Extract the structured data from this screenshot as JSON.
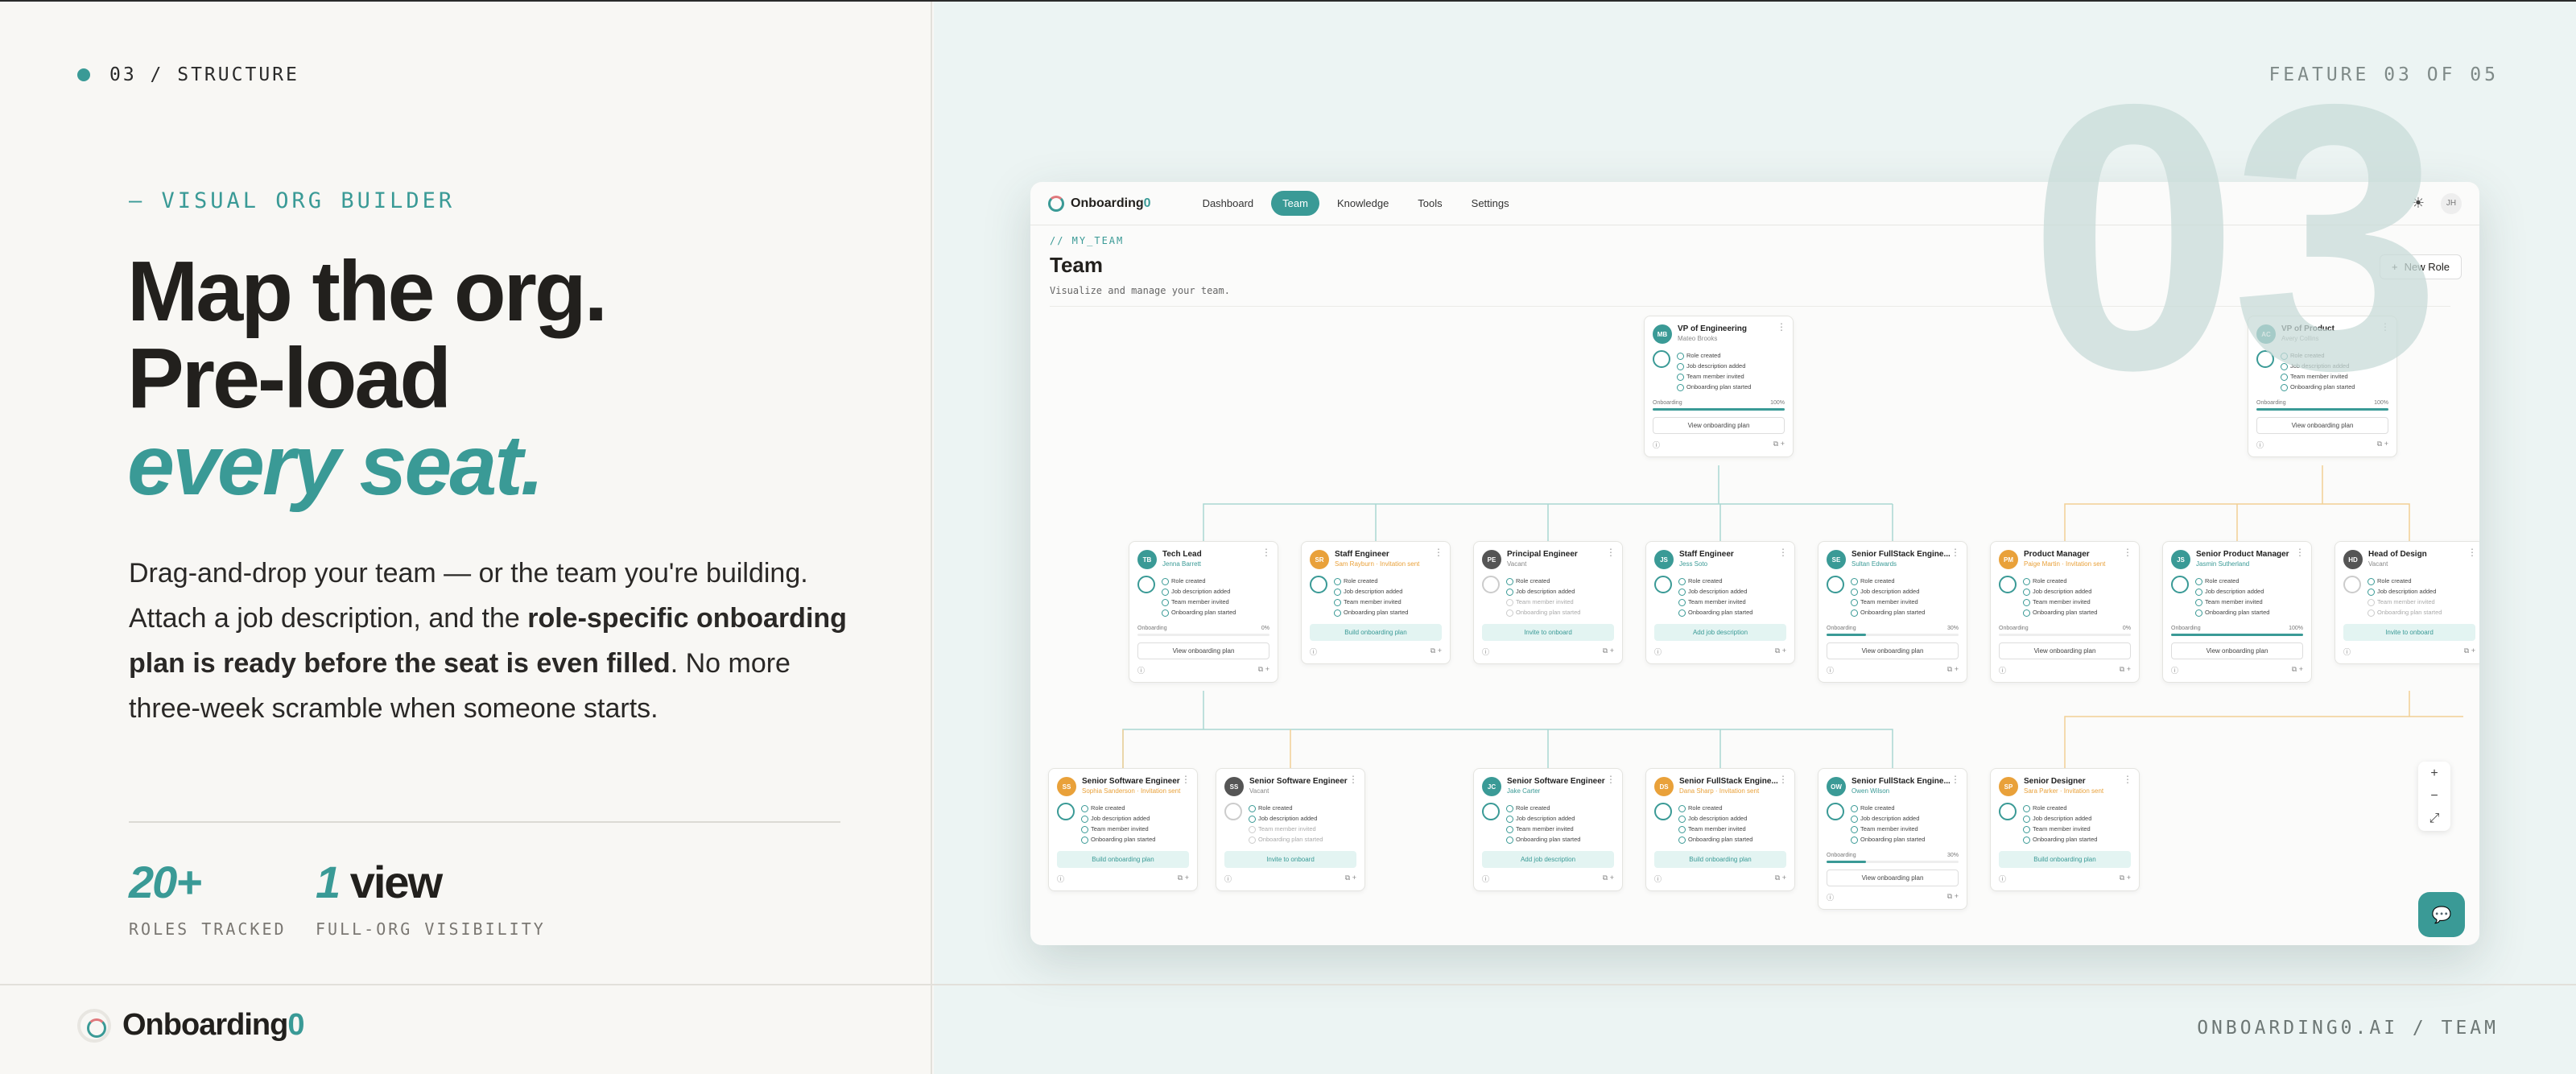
{
  "section": {
    "label": "03 / STRUCTURE"
  },
  "feature_label": "FEATURE 03 OF 05",
  "big_number": "03",
  "eyebrow": "— VISUAL ORG BUILDER",
  "headline": {
    "line1": "Map the org.",
    "line2": "Pre-load",
    "line3": "every seat."
  },
  "body": {
    "part1": "Drag-and-drop your team — or the team you're building. Attach a job description, and the ",
    "bold": "role-specific onboarding plan is ready before the seat is even filled",
    "part2": ". No more three-week scramble when someone starts."
  },
  "stats": [
    {
      "num": "20+",
      "rest": "",
      "caption": "ROLES TRACKED"
    },
    {
      "num": "1",
      "rest": " view",
      "caption": "FULL-ORG VISIBILITY"
    }
  ],
  "brand": {
    "name_main": "Onboarding",
    "name_zero": "0"
  },
  "url_label": "ONBOARDING0.AI / TEAM",
  "colors": {
    "accent": "#3a9a96",
    "amber": "#e9a13a",
    "dark": "#555555",
    "bg_right": "#ecf4f3"
  },
  "app": {
    "brand_main": "Onboarding",
    "brand_zero": "0",
    "nav": [
      "Dashboard",
      "Team",
      "Knowledge",
      "Tools",
      "Settings"
    ],
    "active_nav": "Team",
    "user_initials": "JH",
    "page_eyebrow": "// MY_TEAM",
    "page_title": "Team",
    "page_sub": "Visualize and manage your team.",
    "new_role": "New Role",
    "icons": {
      "theme": "sun-icon",
      "add": "plus-icon",
      "chat": "chat-icon",
      "zoom_in": "plus-icon",
      "zoom_out": "minus-icon",
      "fit": "expand-icon"
    },
    "checklist_labels": [
      "Role created",
      "Job description added",
      "Team member invited",
      "Onboarding plan started"
    ],
    "cards": [
      {
        "initials": "MB",
        "title": "VP of Engineering",
        "person": "Mateo Brooks",
        "status": "normal",
        "color": "#3a9a96",
        "progress": "Onboarding",
        "pct": "100%",
        "pct_value": 1.0,
        "checks": 4,
        "action": "View onboarding plan"
      },
      {
        "initials": "AC",
        "title": "VP of Product",
        "person": "Avery Collins",
        "status": "normal",
        "color": "#3a9a96",
        "progress": "Onboarding",
        "pct": "100%",
        "pct_value": 1.0,
        "checks": 4,
        "action": "View onboarding plan"
      },
      {
        "initials": "TB",
        "title": "Tech Lead",
        "person": "Jenna Barrett",
        "status": "teal",
        "color": "#3a9a96",
        "progress": "Onboarding",
        "pct": "0%",
        "pct_value": 0.0,
        "checks": 4,
        "action": "View onboarding plan"
      },
      {
        "initials": "SR",
        "title": "Staff Engineer",
        "person": "Sam Rayburn · Invitation sent",
        "status": "amber",
        "color": "#e9a13a",
        "checks": 4,
        "action": "Build onboarding plan"
      },
      {
        "initials": "PE",
        "title": "Principal Engineer",
        "person": "Vacant",
        "status": "normal",
        "color": "#555555",
        "checks": 2,
        "action": "Invite to onboard"
      },
      {
        "initials": "JS",
        "title": "Staff Engineer",
        "person": "Jess Soto",
        "status": "teal",
        "color": "#3a9a96",
        "checks": 4,
        "action": "Add job description"
      },
      {
        "initials": "SE",
        "title": "Senior FullStack Engine...",
        "person": "Sultan Edwards",
        "status": "teal",
        "color": "#3a9a96",
        "progress": "Onboarding",
        "pct": "30%",
        "pct_value": 0.3,
        "checks": 4,
        "action": "View onboarding plan"
      },
      {
        "initials": "PM",
        "title": "Product Manager",
        "person": "Paige Martin · Invitation sent",
        "status": "amber",
        "color": "#e9a13a",
        "progress": "Onboarding",
        "pct": "0%",
        "pct_value": 0.0,
        "checks": 4,
        "action": "View onboarding plan"
      },
      {
        "initials": "JS",
        "title": "Senior Product Manager",
        "person": "Jasmin Sutherland",
        "status": "teal",
        "color": "#3a9a96",
        "progress": "Onboarding",
        "pct": "100%",
        "pct_value": 1.0,
        "checks": 4,
        "action": "View onboarding plan"
      },
      {
        "initials": "HD",
        "title": "Head of Design",
        "person": "Vacant",
        "status": "normal",
        "color": "#555555",
        "checks": 2,
        "action": "Invite to onboard"
      },
      {
        "initials": "SS",
        "title": "Senior Software Engineer",
        "person": "Sophia Sanderson · Invitation sent",
        "status": "amber",
        "color": "#e9a13a",
        "checks": 4,
        "action": "Build onboarding plan"
      },
      {
        "initials": "SS",
        "title": "Senior Software Engineer",
        "person": "Vacant",
        "status": "normal",
        "color": "#555555",
        "checks": 2,
        "action": "Invite to onboard"
      },
      {
        "initials": "JC",
        "title": "Senior Software Engineer",
        "person": "Jake Carter",
        "status": "teal",
        "color": "#3a9a96",
        "checks": 4,
        "action": "Add job description"
      },
      {
        "initials": "DS",
        "title": "Senior FullStack Engine...",
        "person": "Dana Sharp · Invitation sent",
        "status": "amber",
        "color": "#e9a13a",
        "checks": 4,
        "action": "Build onboarding plan"
      },
      {
        "initials": "OW",
        "title": "Senior FullStack Engine...",
        "person": "Owen Wilson",
        "status": "teal",
        "color": "#3a9a96",
        "progress": "Onboarding",
        "pct": "30%",
        "pct_value": 0.3,
        "checks": 4,
        "action": "View onboarding plan"
      },
      {
        "initials": "SP",
        "title": "Senior Designer",
        "person": "Sara Parker · Invitation sent",
        "status": "amber",
        "color": "#e9a13a",
        "checks": 4,
        "action": "Build onboarding plan"
      }
    ]
  }
}
